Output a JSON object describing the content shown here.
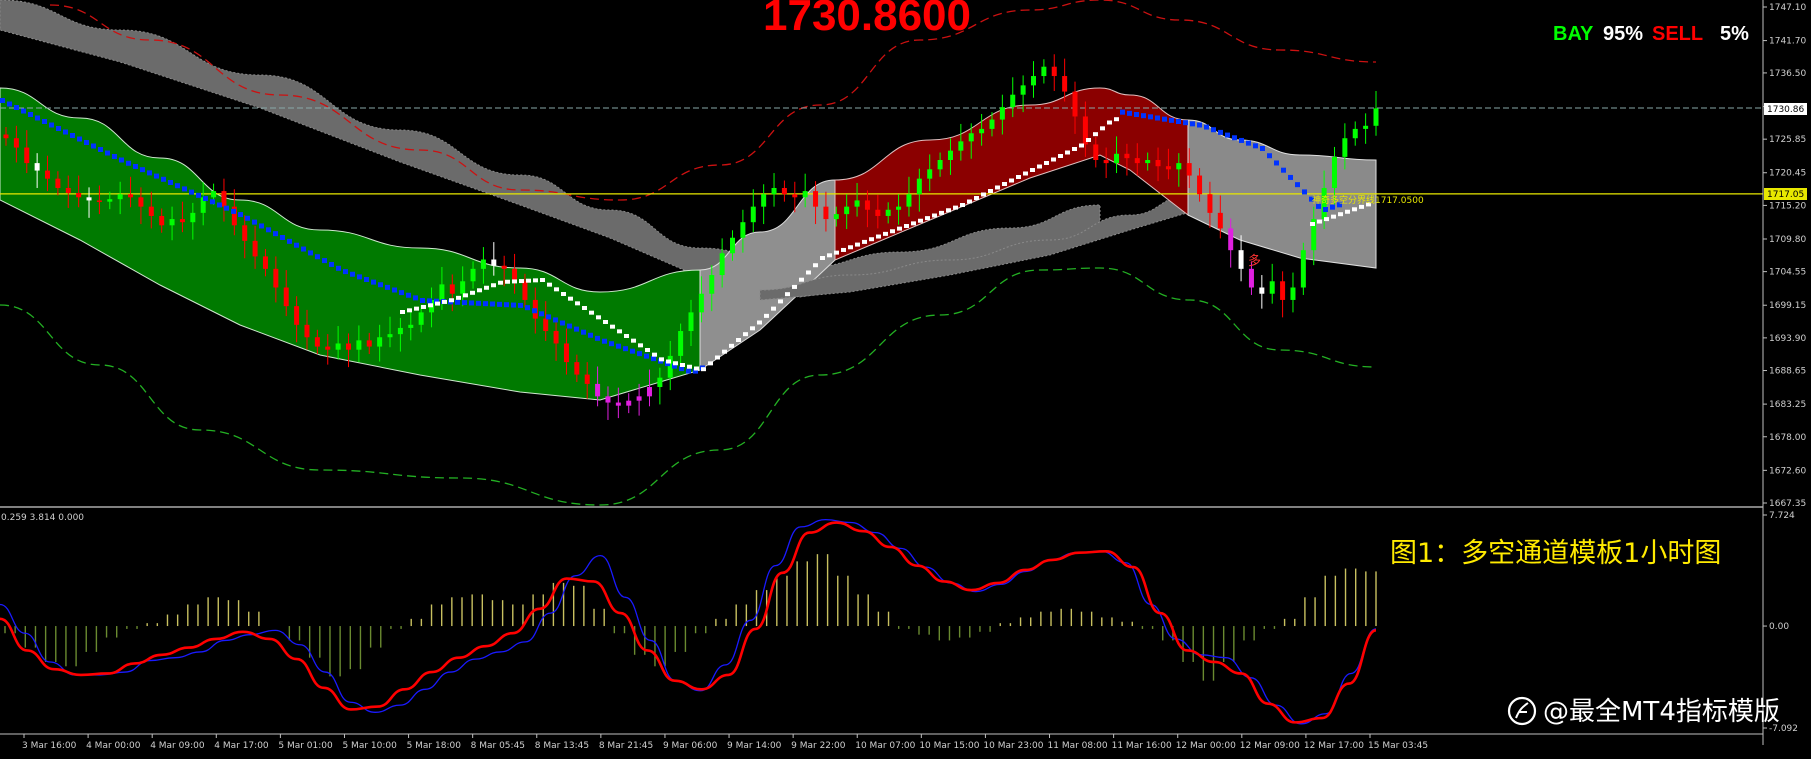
{
  "header": {
    "current_price": "1730.8600",
    "bay_label": "BAY",
    "bay_pct": "95%",
    "sell_label": "SELL",
    "sell_pct": "5%"
  },
  "indicator_header": "0.259 3.814 0.000",
  "figure_caption": "图1：多空通道模板1小时图",
  "watermark": "@最全MT4指标模版",
  "line_label": "神奇多空分界线1717.0500",
  "marker_label": "多",
  "price_tags": {
    "current": "1730.86",
    "level": "1717.05"
  },
  "colors": {
    "bull_candle": "#00ff00",
    "bear_candle": "#ff0000",
    "green_channel": "#007a00",
    "red_channel": "#8b0000",
    "grey_band": "#6b6b6b",
    "blue_line": "#0033ff",
    "signal_line": "#ff0000",
    "macd_line": "#1a1aff",
    "level_line": "#e8e800"
  },
  "chart_data": [
    {
      "type": "candlestick",
      "title": "1730.8600",
      "ylim": [
        1667.35,
        1747.1
      ],
      "y_ticks": [
        "1747.10",
        "1741.70",
        "1736.50",
        "1731.10",
        "1725.85",
        "1720.45",
        "1715.20",
        "1709.80",
        "1704.55",
        "1699.15",
        "1693.90",
        "1688.65",
        "1683.25",
        "1678.00",
        "1672.60",
        "1667.35"
      ],
      "x_ticks": [
        "3 Mar 16:00",
        "4 Mar 00:00",
        "4 Mar 09:00",
        "4 Mar 17:00",
        "5 Mar 01:00",
        "5 Mar 10:00",
        "5 Mar 18:00",
        "8 Mar 05:45",
        "8 Mar 13:45",
        "8 Mar 21:45",
        "9 Mar 06:00",
        "9 Mar 14:00",
        "9 Mar 22:00",
        "10 Mar 07:00",
        "10 Mar 15:00",
        "10 Mar 23:00",
        "11 Mar 08:00",
        "11 Mar 16:00",
        "12 Mar 00:00",
        "12 Mar 09:00",
        "12 Mar 17:00",
        "15 Mar 03:45"
      ],
      "horizontal_lines": [
        {
          "value": 1730.86,
          "style": "dashed"
        },
        {
          "value": 1717.05,
          "style": "solid"
        }
      ],
      "series": [
        {
          "name": "close",
          "values": [
            1726.0,
            1724.5,
            1722.0,
            1720.8,
            1719.5,
            1718.0,
            1717.2,
            1716.5,
            1716.0,
            1715.8,
            1716.2,
            1717.0,
            1716.5,
            1715.0,
            1713.5,
            1712.0,
            1713.0,
            1712.5,
            1714.0,
            1716.5,
            1717.5,
            1715.0,
            1712.0,
            1709.5,
            1707.0,
            1705.0,
            1702.0,
            1699.0,
            1696.0,
            1694.0,
            1692.5,
            1692.0,
            1693.0,
            1692.0,
            1693.5,
            1692.5,
            1694.0,
            1694.5,
            1695.5,
            1696.0,
            1698.0,
            1700.0,
            1702.5,
            1701.0,
            1703.0,
            1705.0,
            1706.5,
            1705.5,
            1705.0,
            1703.0,
            1700.0,
            1697.0,
            1695.0,
            1693.0,
            1690.0,
            1688.0,
            1686.5,
            1684.5,
            1683.5,
            1683.0,
            1683.8,
            1684.5,
            1686.0,
            1687.5,
            1691.0,
            1695.0,
            1698.0,
            1701.0,
            1704.0,
            1707.5,
            1710.0,
            1712.5,
            1715.0,
            1717.0,
            1718.0,
            1717.0,
            1716.5,
            1717.5,
            1715.0,
            1713.0,
            1713.8,
            1715.0,
            1716.0,
            1714.5,
            1713.5,
            1714.5,
            1715.0,
            1717.0,
            1719.5,
            1721.0,
            1722.5,
            1724.0,
            1725.5,
            1726.8,
            1727.5,
            1729.0,
            1731.0,
            1733.0,
            1734.5,
            1736.0,
            1737.5,
            1736.0,
            1733.5,
            1729.5,
            1725.0,
            1722.5,
            1722.0,
            1723.5,
            1722.8,
            1722.0,
            1722.5,
            1721.5,
            1721.0,
            1722.0,
            1720.0,
            1717.0,
            1714.0,
            1711.5,
            1708.0,
            1705.0,
            1702.0,
            1701.0,
            1703.0,
            1700.0,
            1702.0,
            1708.0,
            1713.0,
            1718.0,
            1723.0,
            1726.0,
            1727.5,
            1728.0,
            1730.8
          ]
        }
      ]
    },
    {
      "type": "line",
      "ylim": [
        -7.092,
        7.724
      ],
      "y_ticks": [
        "7.724",
        "0.00",
        "-7.092"
      ],
      "series": [
        {
          "name": "histogram",
          "values": [
            -0.5,
            -1.5,
            -2.5,
            -2.8,
            -1.8,
            -0.8,
            -0.2,
            0.2,
            0.8,
            1.5,
            2.0,
            1.8,
            1.0,
            0.0,
            -1.0,
            -2.2,
            -3.5,
            -3.0,
            -1.5,
            -0.2,
            0.5,
            1.5,
            2.0,
            2.2,
            1.8,
            1.5,
            2.2,
            3.0,
            2.8,
            1.2,
            -0.5,
            -2.0,
            -2.8,
            -1.8,
            -0.5,
            0.5,
            1.5,
            2.5,
            3.5,
            4.5,
            5.0,
            3.5,
            2.2,
            1.0,
            -0.2,
            -0.6,
            -1.0,
            -0.8,
            -0.4,
            0.2,
            0.6,
            1.0,
            1.2,
            1.0,
            0.6,
            0.3,
            -0.2,
            -1.0,
            -2.5,
            -3.8,
            -2.5,
            -1.0,
            -0.2,
            0.5,
            2.0,
            3.5,
            4.0,
            3.8
          ]
        },
        {
          "name": "macd",
          "values": [
            1.5,
            -0.5,
            -2.5,
            -3.4,
            -3.4,
            -3.2,
            -2.4,
            -2.2,
            -1.8,
            -1.0,
            -0.6,
            -0.3,
            -1.3,
            -3.2,
            -5.3,
            -6.0,
            -5.5,
            -4.4,
            -3.2,
            -2.3,
            -1.8,
            -1.1,
            0.9,
            3.5,
            4.9,
            2.0,
            -1.0,
            -3.8,
            -4.5,
            -2.7,
            0.4,
            4.2,
            6.9,
            7.4,
            7.2,
            6.5,
            5.4,
            4.1,
            3.0,
            2.4,
            2.9,
            3.8,
            4.6,
            5.1,
            5.2,
            4.4,
            1.5,
            -0.9,
            -2.0,
            -2.2,
            -3.6,
            -5.5,
            -6.8,
            -6.1,
            -3.3,
            -0.2
          ]
        },
        {
          "name": "signal",
          "values": [
            0.5,
            -1.7,
            -3.0,
            -3.4,
            -3.3,
            -2.6,
            -2.0,
            -1.5,
            -0.9,
            -0.4,
            -0.9,
            -2.3,
            -4.3,
            -5.8,
            -5.6,
            -4.4,
            -3.2,
            -2.2,
            -1.4,
            -0.5,
            1.2,
            3.3,
            3.1,
            0.9,
            -1.7,
            -3.8,
            -4.4,
            -3.4,
            -0.2,
            3.7,
            6.5,
            7.2,
            6.6,
            5.5,
            4.2,
            3.1,
            2.5,
            3.0,
            3.9,
            4.6,
            5.1,
            5.2,
            4.1,
            0.9,
            -1.7,
            -2.5,
            -3.3,
            -5.4,
            -6.7,
            -6.4,
            -4.0,
            -0.3
          ]
        }
      ]
    }
  ]
}
